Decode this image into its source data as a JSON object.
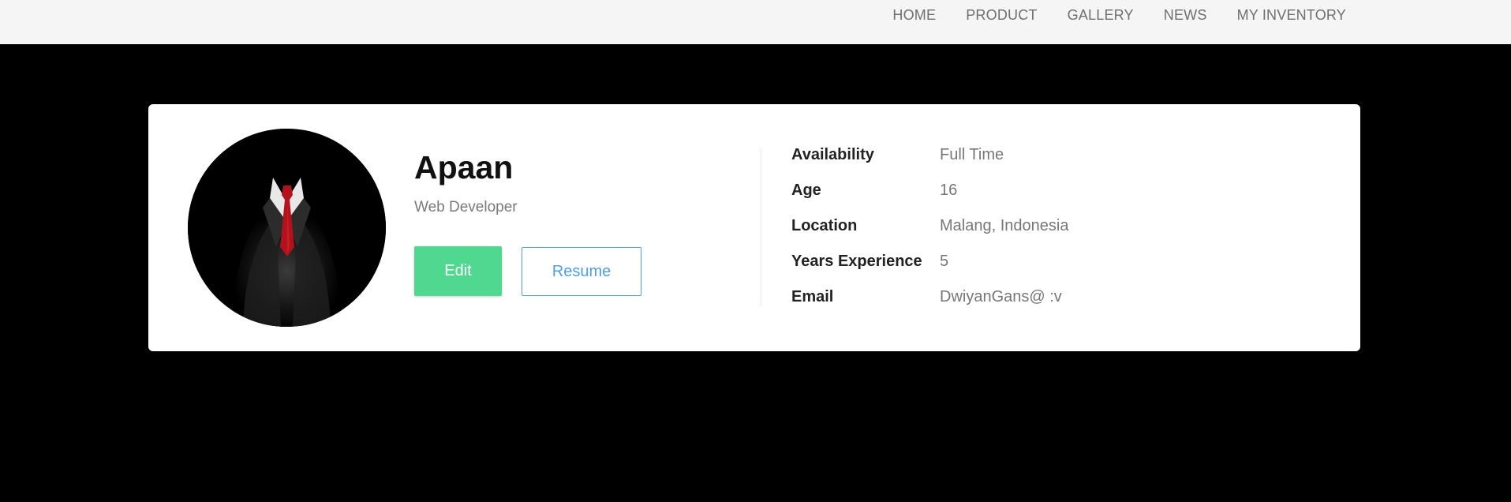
{
  "nav": {
    "items": [
      {
        "label": "HOME"
      },
      {
        "label": "PRODUCT"
      },
      {
        "label": "GALLERY"
      },
      {
        "label": "NEWS"
      },
      {
        "label": "MY INVENTORY"
      }
    ]
  },
  "profile": {
    "name": "Apaan",
    "role": "Web Developer",
    "edit_label": "Edit",
    "resume_label": "Resume",
    "avatar_icon": "suit-person-avatar"
  },
  "details": [
    {
      "key": "Availability",
      "value": "Full Time"
    },
    {
      "key": "Age",
      "value": "16"
    },
    {
      "key": "Location",
      "value": "Malang, Indonesia"
    },
    {
      "key": "Years Experience",
      "value": "5"
    },
    {
      "key": "Email",
      "value": "DwiyanGans@ :v"
    }
  ],
  "colors": {
    "page_background": "#000000",
    "navbar_background": "#f5f5f5",
    "edit_button": "#50d890",
    "resume_accent": "#4d9fe0"
  }
}
